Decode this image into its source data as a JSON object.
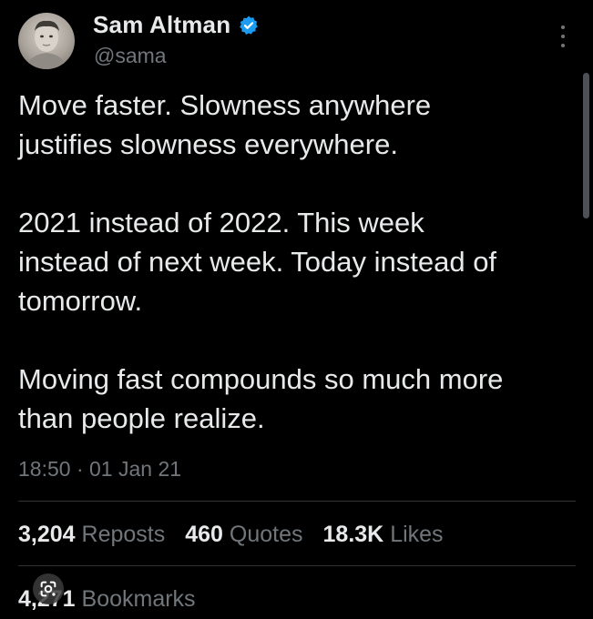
{
  "user": {
    "display_name": "Sam Altman",
    "handle": "@sama",
    "verified": true,
    "verified_color": "#1d9bf0"
  },
  "tweet": {
    "paragraphs": [
      "Move faster. Slowness anywhere\njustifies slowness everywhere.",
      "2021 instead of 2022. This week\ninstead of next week. Today instead of\ntomorrow.",
      "Moving fast compounds so much more\nthan people realize."
    ],
    "time": "18:50",
    "separator": "·",
    "date": "01 Jan 21"
  },
  "stats": {
    "reposts": {
      "count": "3,204",
      "label": "Reposts"
    },
    "quotes": {
      "count": "460",
      "label": "Quotes"
    },
    "likes": {
      "count": "18.3K",
      "label": "Likes"
    },
    "bookmarks": {
      "count": "4,271",
      "label": "Bookmarks"
    }
  },
  "icons": {
    "more": "more-options-icon",
    "verified": "verified-badge-icon",
    "lens": "google-lens-icon"
  },
  "colors": {
    "background": "#000000",
    "primary_text": "#e7e9ea",
    "secondary_text": "#71767b",
    "divider": "#2f3336"
  }
}
